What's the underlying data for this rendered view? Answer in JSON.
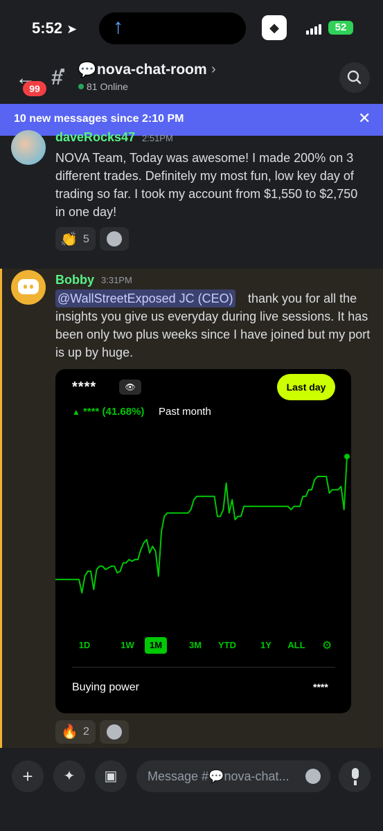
{
  "status_bar": {
    "time": "5:52",
    "battery": "52"
  },
  "header": {
    "unread_badge": "99",
    "channel_emoji": "💬",
    "channel_name": "nova-chat-room",
    "online": "81 Online"
  },
  "banner": {
    "text": "10 new messages since 2:10 PM"
  },
  "messages": [
    {
      "author": "daveRocks47",
      "time": "2:51PM",
      "text": "NOVA Team, Today was awesome!  I made 200% on 3 different trades. Definitely my most fun, low key day of trading so far.  I took my account from $1,550 to $2,750 in one day!",
      "reaction": {
        "emoji": "👏",
        "count": "5"
      }
    },
    {
      "author": "Bobby",
      "time": "3:31PM",
      "mention": "@WallStreetExposed JC (CEO)",
      "text_first": "thank you for all the",
      "text_rest": "insights you give us everyday during live sessions. It has been only two plus weeks since I have joined but my port is up by huge.",
      "reaction": {
        "emoji": "🔥",
        "count": "2"
      }
    }
  ],
  "attachment": {
    "masked_value": "****",
    "last_day_button": "Last day",
    "change_masked": "****",
    "change_pct": "(41.68%)",
    "period": "Past month",
    "ranges": [
      "1D",
      "1W",
      "1M",
      "3M",
      "YTD",
      "1Y",
      "ALL"
    ],
    "active_range": "1M",
    "buying_power_label": "Buying power",
    "buying_power_value": "****",
    "line_color": "#00c805"
  },
  "chart_data": {
    "type": "line",
    "title": "",
    "xlabel": "",
    "ylabel": "",
    "ylim": [
      0,
      100
    ],
    "x": [
      0,
      1,
      2,
      3,
      4,
      5,
      6,
      7,
      8,
      9,
      10,
      11,
      12,
      13,
      14,
      15,
      16,
      17,
      18,
      19,
      20,
      21,
      22,
      23,
      24,
      25,
      26,
      27,
      28,
      29,
      30,
      31,
      32,
      33,
      34,
      35,
      36,
      37,
      38,
      39,
      40,
      41,
      42,
      43,
      44,
      45,
      46,
      47,
      48,
      49,
      50,
      51,
      52,
      53,
      54,
      55,
      56,
      57,
      58,
      59,
      60,
      61,
      62,
      63,
      64,
      65,
      66,
      67,
      68,
      69,
      70,
      71,
      72,
      73,
      74,
      75,
      76,
      77,
      78,
      79,
      80,
      81,
      82,
      83,
      84,
      85,
      86,
      87,
      88,
      89,
      90,
      91,
      92,
      93,
      94,
      95,
      96,
      97,
      98,
      99
    ],
    "values": [
      18,
      18,
      18,
      18,
      18,
      18,
      18,
      18,
      18,
      10,
      20,
      23,
      23,
      12,
      24,
      26,
      26,
      24,
      25,
      26,
      26,
      22,
      23,
      28,
      28,
      30,
      29,
      30,
      30,
      36,
      40,
      42,
      34,
      38,
      35,
      20,
      47,
      56,
      58,
      58,
      58,
      58,
      58,
      58,
      58,
      58,
      60,
      66,
      68,
      68,
      68,
      68,
      68,
      68,
      68,
      56,
      56,
      60,
      76,
      58,
      66,
      54,
      56,
      56,
      62,
      62,
      62,
      62,
      62,
      62,
      62,
      62,
      62,
      62,
      62,
      62,
      62,
      62,
      62,
      62,
      60,
      62,
      62,
      62,
      68,
      68,
      72,
      72,
      78,
      80,
      80,
      80,
      80,
      70,
      72,
      72,
      72,
      74,
      60,
      92
    ]
  },
  "composer": {
    "placeholder": "Message #💬nova-chat..."
  },
  "colors": {
    "accent": "#5865f2",
    "author": "#57f287",
    "highlight_bar": "#f0b232",
    "chart_green": "#00c805",
    "last_day": "#ccff00"
  },
  "icons": [
    "location-arrow-icon",
    "upload-arrow-icon",
    "signal-icon",
    "battery-icon",
    "back-arrow-icon",
    "hashtag-lock-icon",
    "chevron-right-icon",
    "search-icon",
    "close-icon",
    "eye-icon",
    "gear-icon",
    "plus-icon",
    "apps-icon",
    "gift-icon",
    "emoji-icon",
    "mic-icon",
    "discord-logo-icon"
  ]
}
